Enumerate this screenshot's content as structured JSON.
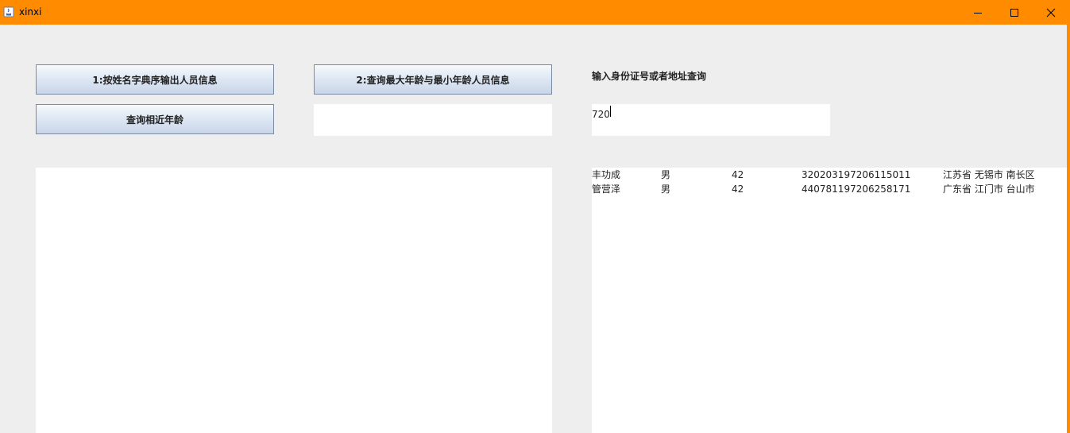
{
  "window": {
    "title": "xinxi",
    "accent": "#ff8c00",
    "controls": [
      "minimize-icon",
      "maximize-icon",
      "close-icon"
    ]
  },
  "buttons": {
    "sort_by_name": "1:按姓名字典序输出人员信息",
    "max_min_age": "2:查询最大年龄与最小年龄人员信息",
    "near_age": "查询相近年龄"
  },
  "age_input": {
    "value": ""
  },
  "query": {
    "label": "输入身份证号或者地址查询",
    "value": "720"
  },
  "results": [
    {
      "name": "丰功成",
      "sex": "男",
      "age": "42",
      "id": "320203197206115011",
      "address": "江苏省 无锡市 南长区"
    },
    {
      "name": "管营泽",
      "sex": "男",
      "age": "42",
      "id": "440781197206258171",
      "address": "广东省 江门市 台山市"
    }
  ]
}
